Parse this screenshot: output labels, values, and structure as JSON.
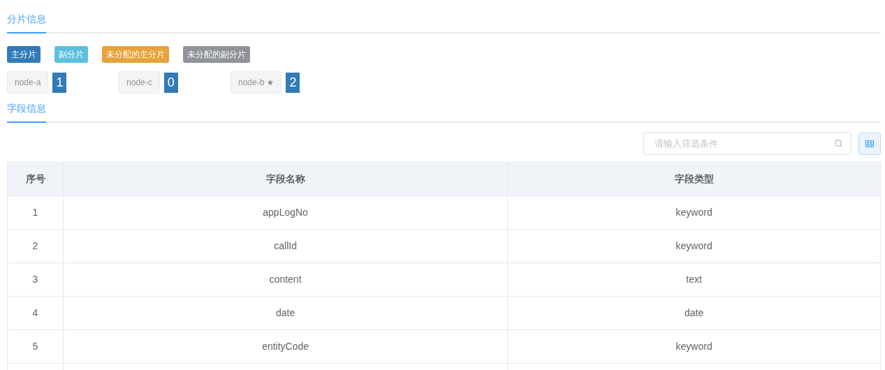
{
  "shard_section": {
    "title": "分片信息"
  },
  "legend": [
    {
      "label": "主分片",
      "color": "#337ab7"
    },
    {
      "label": "副分片",
      "color": "#5bc0de"
    },
    {
      "label": "未分配的主分片",
      "color": "#e6a23c"
    },
    {
      "label": "未分配的副分片",
      "color": "#909399"
    }
  ],
  "nodes": [
    {
      "name": "node-a",
      "master": false,
      "count": "1"
    },
    {
      "name": "node-c",
      "master": false,
      "count": "0"
    },
    {
      "name": "node-b",
      "master": true,
      "count": "2"
    }
  ],
  "field_section": {
    "title": "字段信息"
  },
  "search": {
    "placeholder": "请输入筛选条件"
  },
  "table": {
    "columns": [
      "序号",
      "字段名称",
      "字段类型"
    ],
    "rows": [
      [
        "1",
        "appLogNo",
        "keyword"
      ],
      [
        "2",
        "callId",
        "keyword"
      ],
      [
        "3",
        "content",
        "text"
      ],
      [
        "4",
        "date",
        "date"
      ],
      [
        "5",
        "entityCode",
        "keyword"
      ]
    ]
  }
}
